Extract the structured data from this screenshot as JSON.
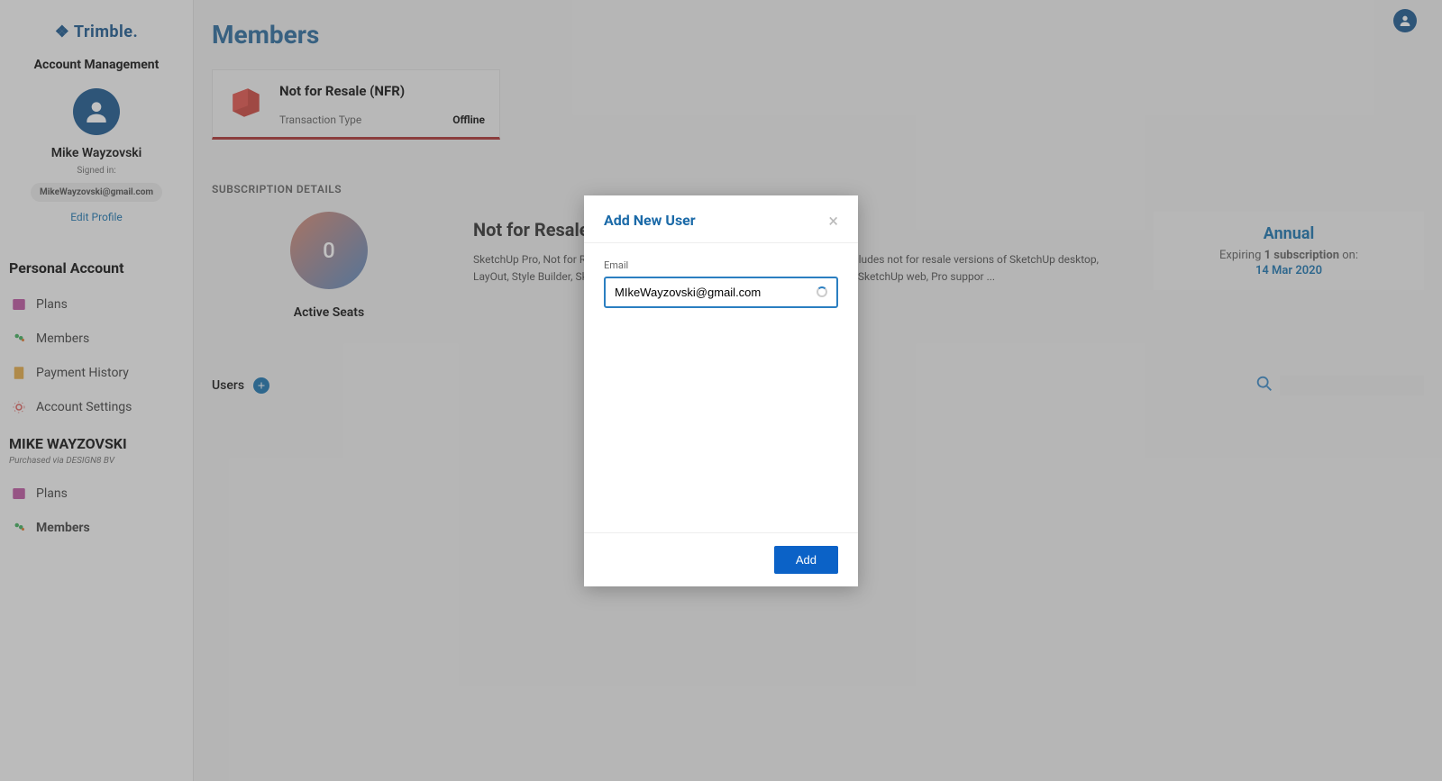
{
  "brand": "Trimble.",
  "sidebar": {
    "section_title": "Account Management",
    "user_name": "Mike Wayzovski",
    "signed_in_label": "Signed in:",
    "email": "MikeWayzovski@gmail.com",
    "edit_profile": "Edit Profile",
    "personal_label": "Personal Account",
    "nav1": [
      {
        "label": "Plans"
      },
      {
        "label": "Members"
      },
      {
        "label": "Payment History"
      },
      {
        "label": "Account Settings"
      }
    ],
    "team_name": "MIKE WAYZOVSKI",
    "purchased_via": "Purchased via DESIGN8 BV",
    "nav2": [
      {
        "label": "Plans"
      },
      {
        "label": "Members"
      }
    ]
  },
  "page": {
    "title": "Members",
    "product": {
      "name": "Not for Resale (NFR)",
      "tx_type_label": "Transaction Type",
      "tx_type_value": "Offline"
    },
    "sub_details_label": "SUBSCRIPTION DETAILS",
    "seats": {
      "count": "0",
      "label": "Active Seats"
    },
    "desc": {
      "title": "Not for Resale (NFR)",
      "body": "SketchUp Pro, Not for Resale use, one year term. SketchUp Pro one year term includes not for resale versions of SketchUp desktop, LayOut, Style Builder, SketchUp Viewer for XR apps, SketchUp Viewer for mobile, SketchUp web, Pro suppor ..."
    },
    "annual": {
      "title": "Annual",
      "expiring_prefix": "Expiring ",
      "subscription_bold": "1 subscription",
      "expiring_suffix": " on:",
      "date": "14 Mar 2020"
    },
    "users_label": "Users"
  },
  "modal": {
    "title": "Add New User",
    "email_label": "Email",
    "email_value": "MIkeWayzovski@gmail.com",
    "add_button": "Add"
  }
}
